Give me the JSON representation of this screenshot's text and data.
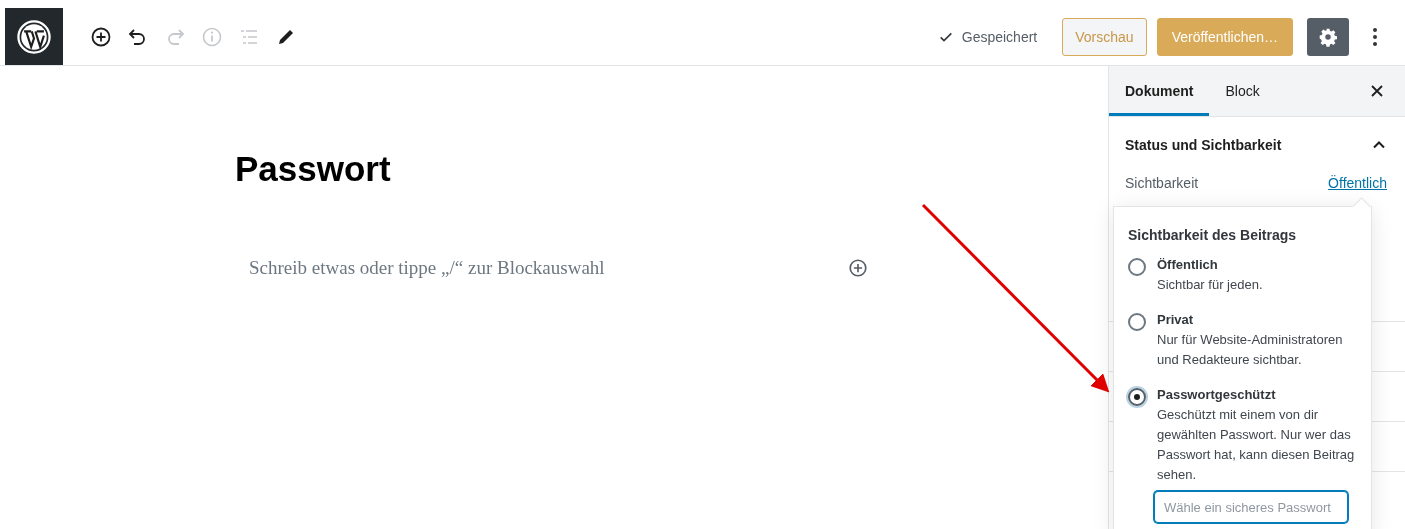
{
  "header": {
    "tools": [
      {
        "kind": "add",
        "disabled": false
      },
      {
        "kind": "undo",
        "disabled": false
      },
      {
        "kind": "redo",
        "disabled": true
      },
      {
        "kind": "info",
        "disabled": true
      },
      {
        "kind": "outline",
        "disabled": true
      },
      {
        "kind": "edit",
        "disabled": false
      }
    ],
    "saved_status": "Gespeichert",
    "preview_button": "Vorschau",
    "publish_button": "Veröffentlichen…",
    "settings_button": {
      "selected": true
    }
  },
  "editor": {
    "title": "Passwort",
    "placeholder": "Schreib etwas oder tippe „/“ zur Blockauswahl"
  },
  "sidebar": {
    "tabs": [
      {
        "label": "Dokument",
        "selected": true
      },
      {
        "label": "Block",
        "selected": false
      }
    ],
    "panel": {
      "title": "Status und Sichtbarkeit",
      "expanded": true,
      "visibility_label": "Sichtbarkeit",
      "visibility_value": "Öffentlich"
    }
  },
  "popover": {
    "title": "Sichtbarkeit des Beitrags",
    "options": [
      {
        "label": "Öffentlich",
        "description": "Sichtbar für jeden.",
        "selected": false
      },
      {
        "label": "Privat",
        "description": "Nur für Website-Administratoren und Redakteure sichtbar.",
        "selected": false
      },
      {
        "label": "Passwortgeschützt",
        "description": "Geschützt mit einem von dir gewählten Passwort. Nur wer das Passwort hat, kann diesen Beitrag sehen.",
        "selected": true
      }
    ],
    "password_field": {
      "placeholder": "Wähle ein sicheres Passwort"
    }
  }
}
